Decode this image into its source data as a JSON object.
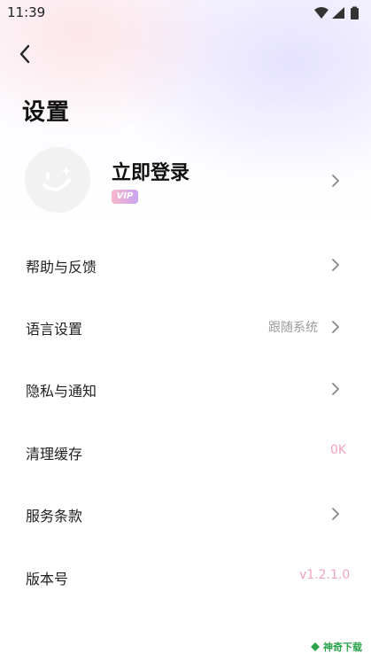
{
  "status_bar": {
    "time": "11:39"
  },
  "header": {
    "title": "设置"
  },
  "profile": {
    "login_label": "立即登录",
    "vip_label": "VIP"
  },
  "menu": {
    "items": [
      {
        "label": "帮助与反馈",
        "value": "",
        "has_chevron": true
      },
      {
        "label": "语言设置",
        "value": "跟随系统",
        "has_chevron": true
      },
      {
        "label": "隐私与通知",
        "value": "",
        "has_chevron": true
      },
      {
        "label": "清理缓存",
        "value": "0K",
        "has_chevron": false
      },
      {
        "label": "服务条款",
        "value": "",
        "has_chevron": true
      },
      {
        "label": "版本号",
        "value": "v1.2.1.0",
        "has_chevron": false
      }
    ]
  },
  "watermark": {
    "text": "神奇下载"
  },
  "colors": {
    "accent_pink": "#f2a3bd",
    "secondary_text": "#9a9a9a",
    "vip_gradient_start": "#f7b7c8",
    "vip_gradient_end": "#c9a4f2"
  },
  "icons": [
    "wifi-icon",
    "signal-icon",
    "battery-icon",
    "back-arrow-icon",
    "avatar-face-icon",
    "chevron-right-icon",
    "watermark-logo-icon"
  ]
}
